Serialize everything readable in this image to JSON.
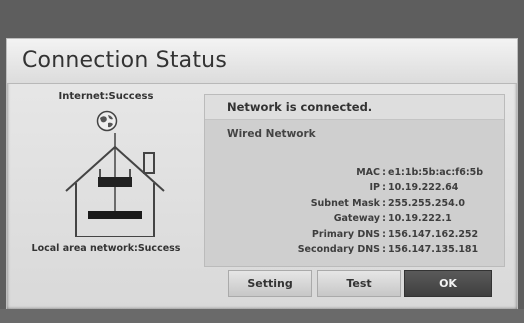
{
  "dialog": {
    "title": "Connection Status"
  },
  "diagram": {
    "internet_status": "Internet:Success",
    "lan_status": "Local area network:Success",
    "globe_icon": "globe-icon",
    "house_icon": "house-router-icon"
  },
  "info": {
    "status": "Network is connected.",
    "type": "Wired Network",
    "rows": [
      {
        "label": "MAC",
        "value": "e1:1b:5b:ac:f6:5b"
      },
      {
        "label": "IP",
        "value": "10.19.222.64"
      },
      {
        "label": "Subnet Mask",
        "value": "255.255.254.0"
      },
      {
        "label": "Gateway",
        "value": "10.19.222.1"
      },
      {
        "label": "Primary DNS",
        "value": "156.147.162.252"
      },
      {
        "label": "Secondary DNS",
        "value": "156.147.135.181"
      }
    ]
  },
  "buttons": {
    "setting": "Setting",
    "test": "Test",
    "ok": "OK"
  },
  "colors": {
    "ok_button": "#4a4a4a",
    "dialog_bg": "#e2e2e2",
    "panel_bg": "#cfcfcf"
  }
}
